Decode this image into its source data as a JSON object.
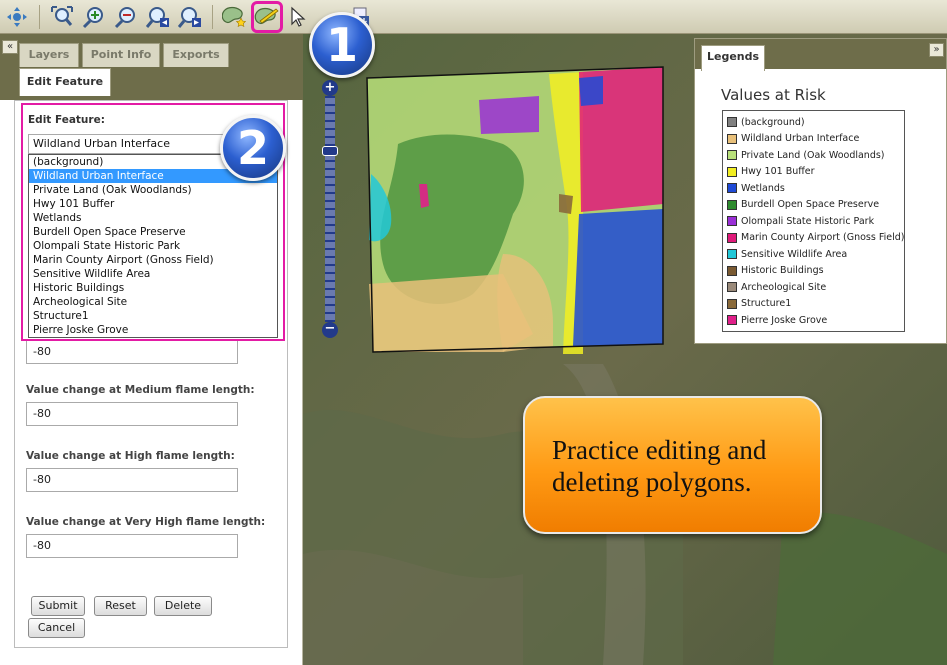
{
  "toolbar": {
    "tools": [
      {
        "name": "pan-icon"
      },
      {
        "name": "zoom-full-extent-icon"
      },
      {
        "name": "zoom-in-icon"
      },
      {
        "name": "zoom-out-icon"
      },
      {
        "name": "zoom-previous-icon"
      },
      {
        "name": "zoom-next-icon"
      },
      {
        "name": "add-polygon-icon"
      },
      {
        "name": "edit-polygon-icon"
      },
      {
        "name": "select-arrow-icon"
      },
      {
        "name": "export-icon"
      }
    ],
    "active_tool": "edit-polygon-icon",
    "highlight_color": "#e31ba5"
  },
  "badges": {
    "one": "1",
    "two": "2"
  },
  "left_panel": {
    "collapse_label": "«",
    "tabs": [
      "Layers",
      "Point Info",
      "Exports"
    ],
    "active_tab": "Edit Feature",
    "edit_feature": {
      "title": "Edit Feature:",
      "selected": "Wildland Urban Interface",
      "options": [
        "(background)",
        "Wildland Urban Interface",
        "Private Land (Oak Woodlands)",
        "Hwy 101 Buffer",
        "Wetlands",
        "Burdell Open Space Preserve",
        "Olompali State Historic Park",
        "Marin County Airport (Gnoss Field)",
        "Sensitive Wildlife Area",
        "Historic Buildings",
        "Archeological Site",
        "Structure1",
        "Pierre Joske Grove"
      ]
    },
    "fields": [
      {
        "label": "",
        "value": "-80"
      },
      {
        "label": "Value change at Medium flame length:",
        "value": "-80"
      },
      {
        "label": "Value change at High flame length:",
        "value": "-80"
      },
      {
        "label": "Value change at Very High flame length:",
        "value": "-80"
      }
    ],
    "buttons": {
      "submit": "Submit",
      "reset": "Reset",
      "delete": "Delete",
      "cancel": "Cancel"
    }
  },
  "legend": {
    "tab": "Legends",
    "collapse_label": "»",
    "title": "Values at Risk",
    "items": [
      {
        "label": "(background)",
        "color": "#808080"
      },
      {
        "label": "Wildland Urban Interface",
        "color": "#e8c07a"
      },
      {
        "label": "Private Land (Oak Woodlands)",
        "color": "#b8e07a"
      },
      {
        "label": "Hwy 101 Buffer",
        "color": "#f2ee22"
      },
      {
        "label": "Wetlands",
        "color": "#1f4ad6"
      },
      {
        "label": "Burdell Open Space Preserve",
        "color": "#2e8b2e"
      },
      {
        "label": "Olompali State Historic Park",
        "color": "#9a2fd6"
      },
      {
        "label": "Marin County Airport (Gnoss Field)",
        "color": "#e01a7a"
      },
      {
        "label": "Sensitive Wildlife Area",
        "color": "#22c8d8"
      },
      {
        "label": "Historic Buildings",
        "color": "#7a5a32"
      },
      {
        "label": "Archeological Site",
        "color": "#9a8a7a"
      },
      {
        "label": "Structure1",
        "color": "#8a6a3a"
      },
      {
        "label": "Pierre Joske Grove",
        "color": "#e0208a"
      }
    ]
  },
  "callout": {
    "line1": "Practice editing and",
    "line2": "deleting polygons."
  },
  "map": {
    "zoom_in": "+",
    "zoom_out": "−"
  }
}
